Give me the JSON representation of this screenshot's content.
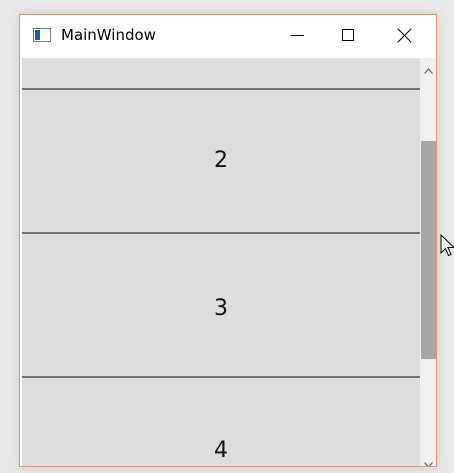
{
  "window": {
    "title": "MainWindow"
  },
  "titlebar_buttons": {
    "minimize": "minimize-icon",
    "maximize": "maximize-icon",
    "close": "close-icon"
  },
  "list": {
    "items": [
      {
        "label": ""
      },
      {
        "label": "2"
      },
      {
        "label": "3"
      },
      {
        "label": "4"
      }
    ]
  },
  "colors": {
    "window_border": "#e8926a",
    "item_background": "#dddddd",
    "divider": "#707070",
    "scroll_thumb": "#a6a6a6",
    "scroll_track": "#f0f0f0"
  },
  "scrollbar": {
    "position_fraction": 0.4
  }
}
